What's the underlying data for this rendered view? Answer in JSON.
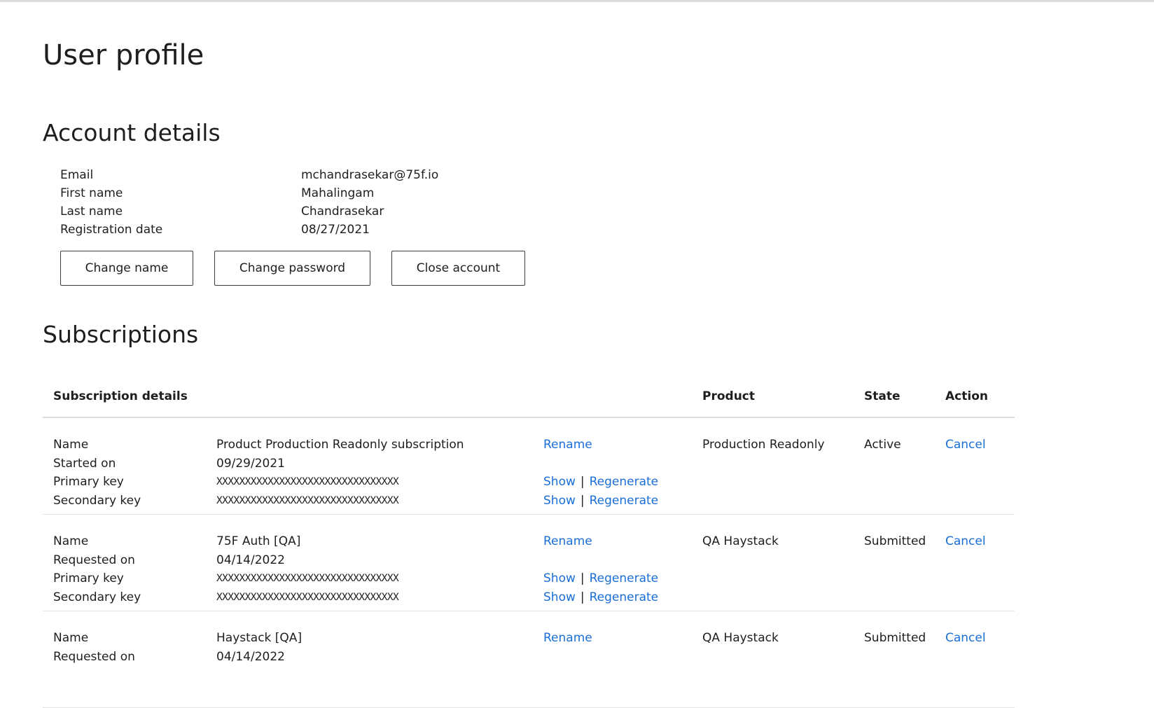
{
  "page": {
    "title": "User profile"
  },
  "account": {
    "heading": "Account details",
    "fields": [
      {
        "label": "Email",
        "value": "mchandrasekar@75f.io"
      },
      {
        "label": "First name",
        "value": "Mahalingam"
      },
      {
        "label": "Last name",
        "value": "Chandrasekar"
      },
      {
        "label": "Registration date",
        "value": "08/27/2021"
      }
    ],
    "buttons": {
      "change_name": "Change name",
      "change_password": "Change password",
      "close_account": "Close account"
    }
  },
  "subscriptions": {
    "heading": "Subscriptions",
    "columns": {
      "details": "Subscription details",
      "product": "Product",
      "state": "State",
      "action": "Action"
    },
    "link_labels": {
      "rename": "Rename",
      "show": "Show",
      "separator": "|",
      "regenerate": "Regenerate",
      "cancel": "Cancel"
    },
    "rows": [
      {
        "labels": [
          "Name",
          "Started on",
          "Primary key",
          "Secondary key"
        ],
        "name": "Product Production Readonly subscription",
        "date": "09/29/2021",
        "primary_key": "XXXXXXXXXXXXXXXXXXXXXXXXXXXXXXXX",
        "secondary_key": "XXXXXXXXXXXXXXXXXXXXXXXXXXXXXXXX",
        "product": "Production Readonly",
        "state": "Active"
      },
      {
        "labels": [
          "Name",
          "Requested on",
          "Primary key",
          "Secondary key"
        ],
        "name": "75F Auth [QA]",
        "date": "04/14/2022",
        "primary_key": "XXXXXXXXXXXXXXXXXXXXXXXXXXXXXXXX",
        "secondary_key": "XXXXXXXXXXXXXXXXXXXXXXXXXXXXXXXX",
        "product": "QA Haystack",
        "state": "Submitted"
      },
      {
        "labels": [
          "Name",
          "Requested on"
        ],
        "name": "Haystack [QA]",
        "date": "04/14/2022",
        "product": "QA Haystack",
        "state": "Submitted"
      }
    ]
  }
}
